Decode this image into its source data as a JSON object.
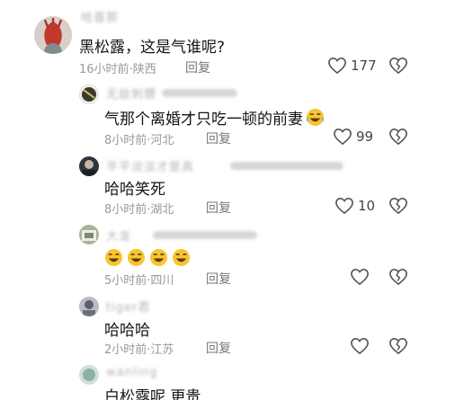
{
  "comments": [
    {
      "username": "哈喜那",
      "text": "黑松露，这是气谁呢?",
      "time": "16小时前",
      "location": "陕西",
      "reply_label": "回复",
      "likes": "177",
      "avatar_color": "#c0392b"
    },
    {
      "username": "无敌刺猬",
      "text": "气那个离婚才只吃一顿的前妻",
      "emoji": "laughing-tears",
      "time": "8小时前",
      "location": "河北",
      "reply_label": "回复",
      "likes": "99",
      "avatar_color": "#4a4a3a"
    },
    {
      "username": "平平淡淡才是真",
      "text": "哈哈笑死",
      "time": "8小时前",
      "location": "湖北",
      "reply_label": "回复",
      "likes": "10",
      "avatar_color": "#3a3f4a"
    },
    {
      "username": "大龙",
      "text": "",
      "emoji_count": 4,
      "time": "5小时前",
      "location": "四川",
      "reply_label": "回复",
      "likes": "",
      "avatar_color": "#8a9a7a"
    },
    {
      "username": "tiger君",
      "text": "哈哈哈",
      "time": "2小时前",
      "location": "江苏",
      "reply_label": "回复",
      "likes": "",
      "avatar_color": "#7a7f8a"
    },
    {
      "username": "wanling",
      "text": "白松露呢 更贵",
      "time": "",
      "location": "",
      "reply_label": "",
      "likes": "",
      "avatar_color": "#8fb0a8"
    }
  ],
  "separator": "·",
  "colors": {
    "meta": "#999999",
    "text": "#141414"
  }
}
